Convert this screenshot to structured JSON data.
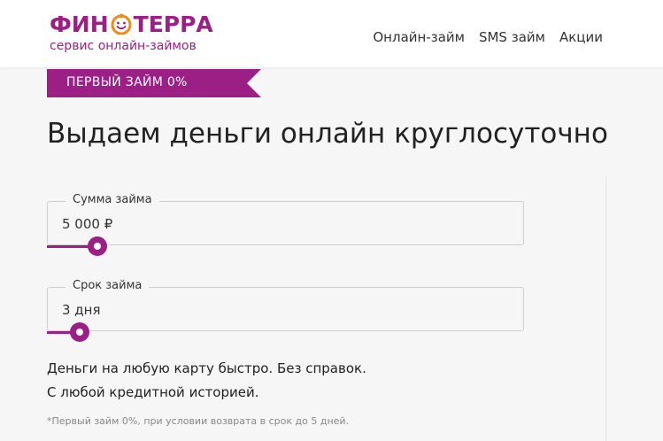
{
  "header": {
    "logo": {
      "brand_left": "ФИН",
      "brand_right": "ТЕРРА",
      "tagline": "сервис онлайн-займов",
      "mark_icon": "face-coin-icon"
    },
    "nav": [
      {
        "label": "Онлайн-займ"
      },
      {
        "label": "SMS займ"
      },
      {
        "label": "Акции"
      }
    ]
  },
  "promo": {
    "label": "ПЕРВЫЙ ЗАЙМ 0%"
  },
  "main": {
    "title": "Выдаем деньги онлайн круглосуточно",
    "amount": {
      "legend": "Сумма займа",
      "value": "5 000 ₽",
      "slider_fraction": 0.106
    },
    "term": {
      "legend": "Срок займа",
      "value": "3 дня",
      "slider_fraction": 0.069
    },
    "desc_line1": "Деньги на любую карту быстро. Без справок.",
    "desc_line2": "С любой кредитной историей.",
    "footnote": "*Первый займ 0%, при условии возврата в срок до 5 дней."
  },
  "colors": {
    "brand": "#9c1f86",
    "background": "#f6f6f6"
  }
}
